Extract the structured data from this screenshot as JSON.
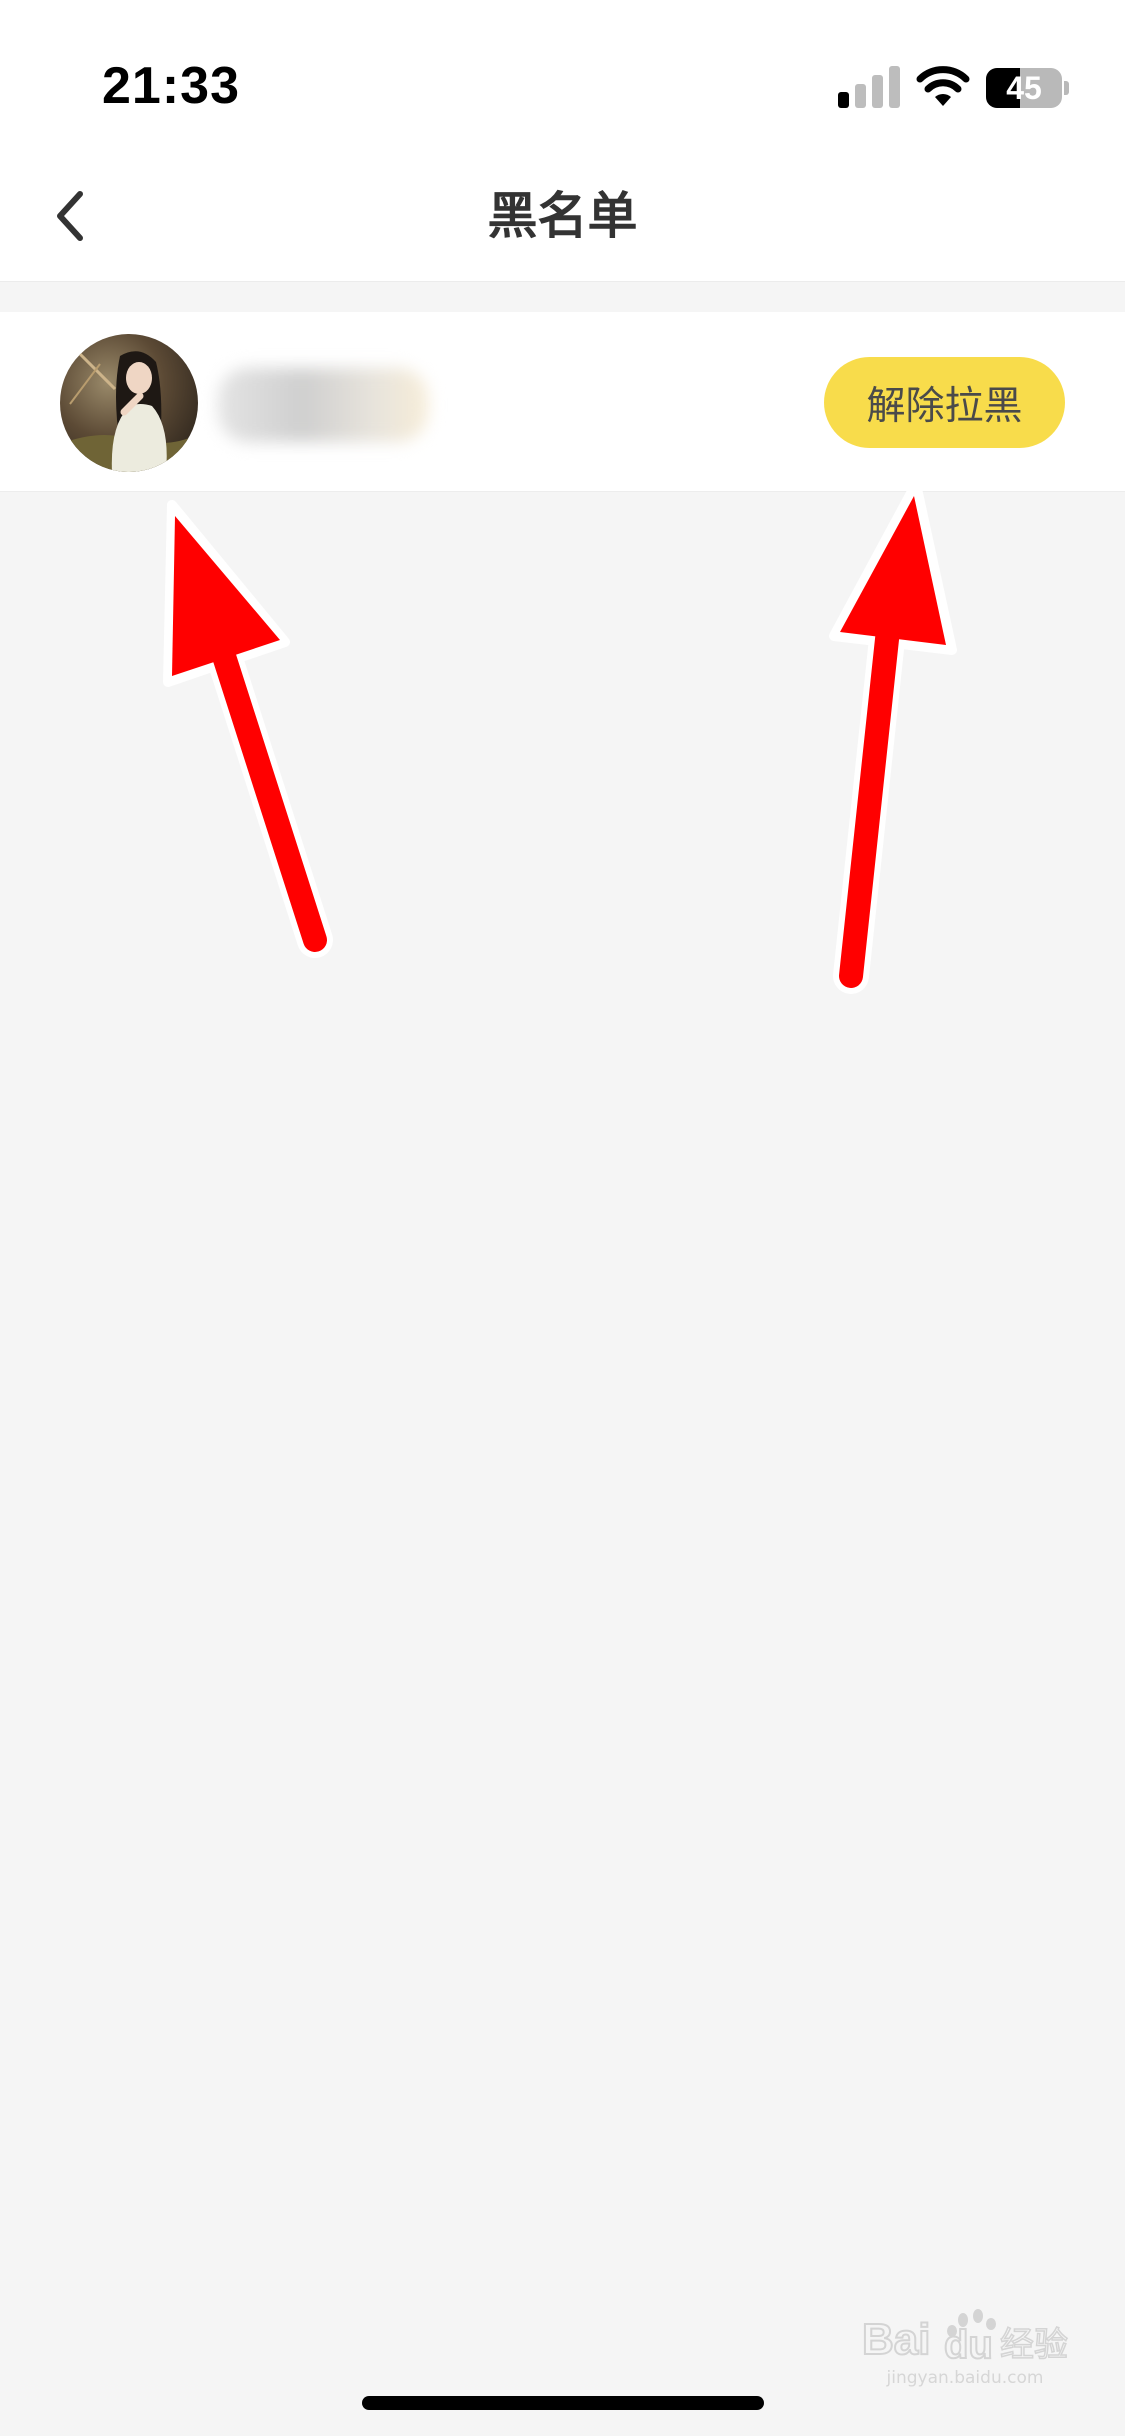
{
  "status_bar": {
    "time": "21:33",
    "battery_level": "45",
    "battery_fraction": 0.45,
    "signal_bars_active": 1,
    "signal_bars_total": 4,
    "icons": [
      "cellular-signal-icon",
      "wifi-icon",
      "battery-icon"
    ]
  },
  "nav": {
    "title": "黑名单",
    "back_icon": "chevron-left-icon"
  },
  "blacklist": {
    "items": [
      {
        "avatar": "user-avatar-photo",
        "username": "",
        "action_label": "解除拉黑"
      }
    ]
  },
  "colors": {
    "button_bg": "#f8dc4b",
    "page_bg": "#f5f5f5",
    "annotation_arrow": "#ff0000"
  },
  "watermark": {
    "text": "jingyan.baidu.com"
  }
}
